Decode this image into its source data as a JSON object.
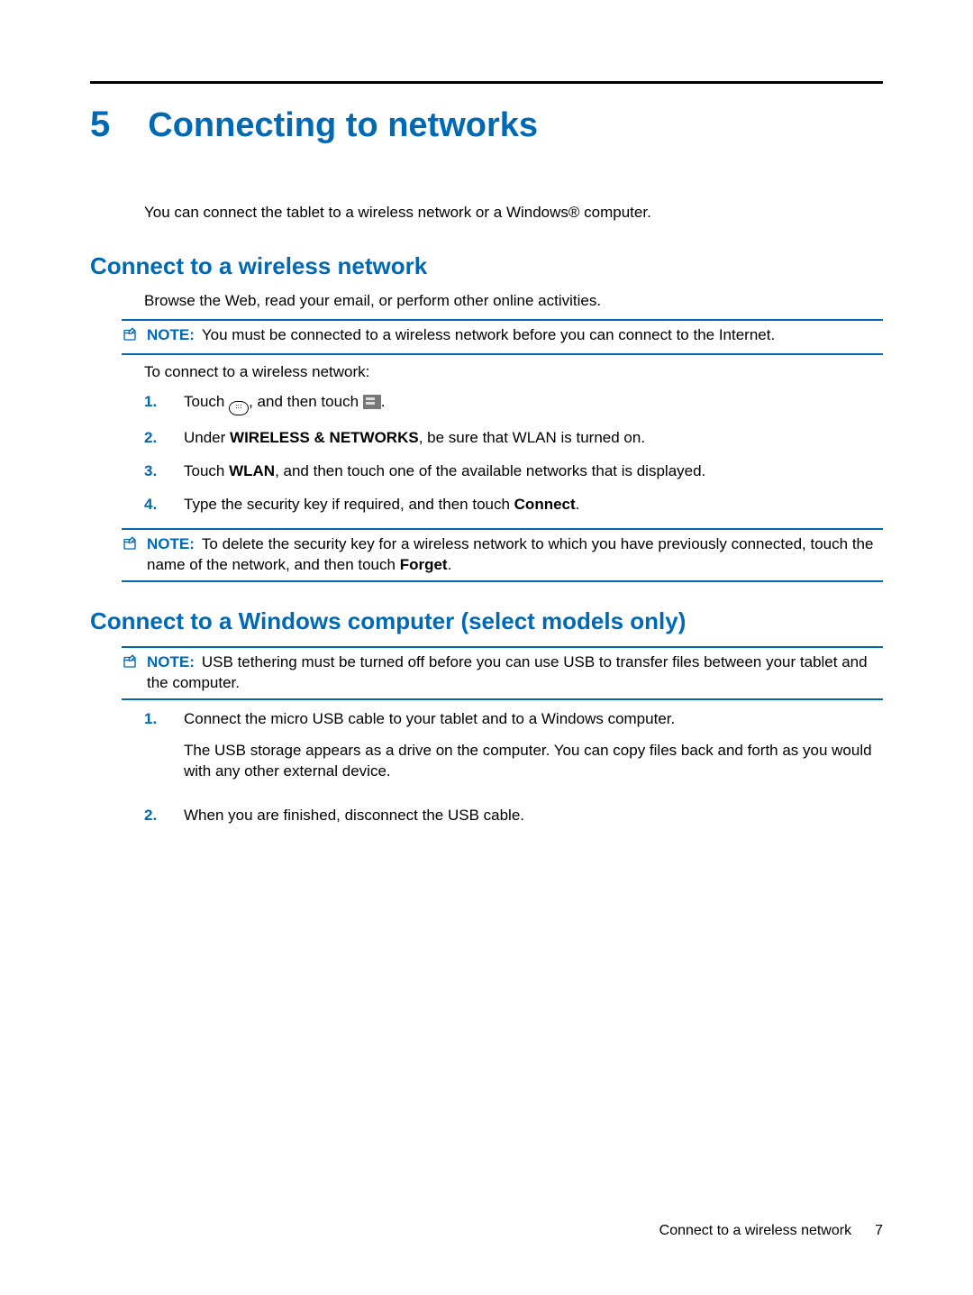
{
  "chapter": {
    "number": "5",
    "title": "Connecting to networks"
  },
  "intro": "You can connect the tablet to a wireless network or a Windows® computer.",
  "section1": {
    "heading": "Connect to a wireless network",
    "intro": "Browse the Web, read your email, or perform other online activities.",
    "note1": {
      "label": "NOTE:",
      "text": "You must be connected to a wireless network before you can connect to the Internet."
    },
    "lead": "To connect to a wireless network:",
    "steps": {
      "s1_num": "1.",
      "s1_a": "Touch ",
      "s1_b": ", and then touch ",
      "s1_c": ".",
      "s2_num": "2.",
      "s2_a": "Under ",
      "s2_bold": "WIRELESS & NETWORKS",
      "s2_b": ", be sure that WLAN is turned on.",
      "s3_num": "3.",
      "s3_a": "Touch ",
      "s3_bold": "WLAN",
      "s3_b": ", and then touch one of the available networks that is displayed.",
      "s4_num": "4.",
      "s4_a": "Type the security key if required, and then touch ",
      "s4_bold": "Connect",
      "s4_b": "."
    },
    "note2": {
      "label": "NOTE:",
      "a": "To delete the security key for a wireless network to which you have previously connected, touch the name of the network, and then touch ",
      "bold": "Forget",
      "b": "."
    }
  },
  "section2": {
    "heading": "Connect to a Windows computer (select models only)",
    "note": {
      "label": "NOTE:",
      "text": "USB tethering must be turned off before you can use USB to transfer files between your tablet and the computer."
    },
    "steps": {
      "s1_num": "1.",
      "s1_a": "Connect the micro USB cable to your tablet and to a Windows computer.",
      "s1_b": "The USB storage appears as a drive on the computer. You can copy files back and forth as you would with any other external device.",
      "s2_num": "2.",
      "s2_a": "When you are finished, disconnect the USB cable."
    }
  },
  "footer": {
    "section": "Connect to a wireless network",
    "page": "7"
  }
}
